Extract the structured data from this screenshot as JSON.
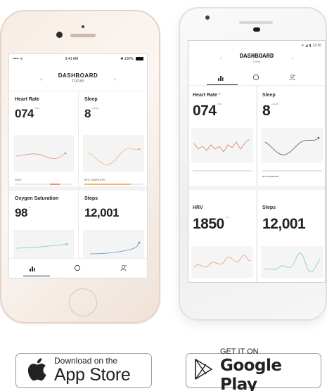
{
  "iphone": {
    "status": {
      "carrier": "••••• ᯤ",
      "time": "9:41 AM",
      "bluetooth": "✱",
      "battery": "100%"
    },
    "header": {
      "title": "DASHBOARD",
      "subtitle": "TODAY",
      "prev_icon": "chevron-left-icon",
      "next_icon": "chevron-right-icon"
    },
    "cards": [
      {
        "label": "Heart Rate",
        "value": "074",
        "unit": "/ BPM",
        "note": "HIGH",
        "color": "#f08a7a"
      },
      {
        "label": "Sleep",
        "value": "8",
        "unit": "/ HOURS",
        "note": "80% COMPLETE",
        "color": "#f3b96b"
      },
      {
        "label": "Oxygen Saturation",
        "value": "98",
        "unit": "%",
        "color": "#6fd6b5"
      },
      {
        "label": "Steps",
        "value": "12,001",
        "color": "#5b8de8"
      }
    ],
    "tabs": [
      "bar-chart-icon",
      "circle-icon",
      "person-add-icon"
    ]
  },
  "android": {
    "status": {
      "time": "12:30"
    },
    "header": {
      "title": "DASHBOARD",
      "subtitle": "Today"
    },
    "tabs": [
      "bar-chart-icon",
      "circle-icon",
      "person-add-icon"
    ],
    "cards": [
      {
        "label": "Heart Rate",
        "label_mark": "*",
        "value": "074",
        "unit": "/ BPM"
      },
      {
        "label": "Sleep",
        "value": "8",
        "unit": "/ HOURS",
        "note": "80% COMPLETE"
      },
      {
        "label": "HRV",
        "value": "1850",
        "unit": "CAL"
      },
      {
        "label": "Steps",
        "value": "12,001"
      }
    ]
  },
  "badges": {
    "apple": {
      "small": "Download on the",
      "big": "App Store",
      "icon": "apple-logo-icon"
    },
    "google": {
      "small": "GET IT ON",
      "big": "Google Play",
      "icon": "google-play-icon"
    }
  }
}
